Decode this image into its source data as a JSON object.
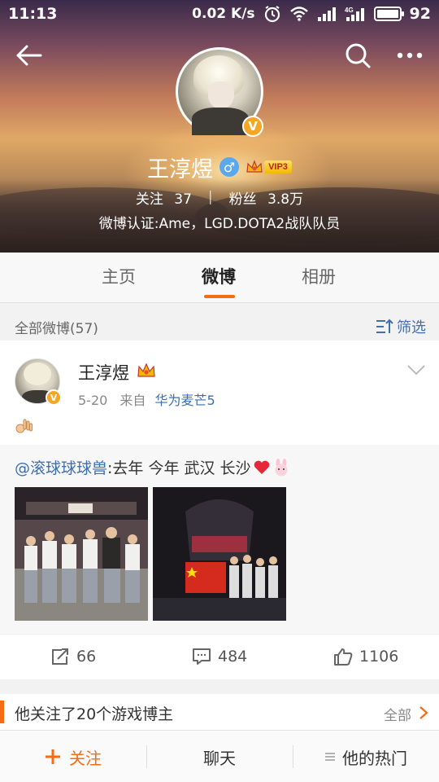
{
  "status_bar": {
    "time": "11:13",
    "net_speed": "0.02 K/s",
    "net_type": "4G",
    "battery": "92"
  },
  "profile": {
    "name": "王淳煜",
    "gender": "male",
    "vip_level": "VIP3",
    "following_label": "关注",
    "following_count": "37",
    "followers_label": "粉丝",
    "followers_count": "3.8万",
    "verified_text": "微博认证:Ame，LGD.DOTA2战队队员"
  },
  "tabs": [
    {
      "label": "主页",
      "active": false
    },
    {
      "label": "微博",
      "active": true
    },
    {
      "label": "相册",
      "active": false
    }
  ],
  "filter_bar": {
    "label": "全部微博(57)",
    "filter_label": "筛选"
  },
  "post": {
    "author": "王淳煜",
    "date": "5-20",
    "source_prefix": "来自",
    "source": "华为麦芒5",
    "repost": {
      "mention": "@滚球球球兽",
      "text": ":去年 今年 武汉 长沙"
    },
    "repost_count": "66",
    "comment_count": "484",
    "like_count": "1106"
  },
  "promo": {
    "text": "他关注了20个游戏博主",
    "all_label": "全部"
  },
  "bottom_bar": {
    "follow_label": "关注",
    "chat_label": "聊天",
    "hot_label": "他的热门"
  },
  "colors": {
    "accent": "#f46c14",
    "link": "#3e6fb0",
    "vip_gold": "#f5b800"
  },
  "icons": [
    "back-arrow-icon",
    "search-icon",
    "more-icon",
    "verified-v-icon",
    "male-icon",
    "vip-crown-icon",
    "filter-icon",
    "chevron-down-icon",
    "ok-hand-emoji-icon",
    "heart-emoji-icon",
    "bunny-emoji-icon",
    "repost-icon",
    "comment-icon",
    "like-icon",
    "chevron-right-icon",
    "plus-icon",
    "menu-lines-icon"
  ]
}
